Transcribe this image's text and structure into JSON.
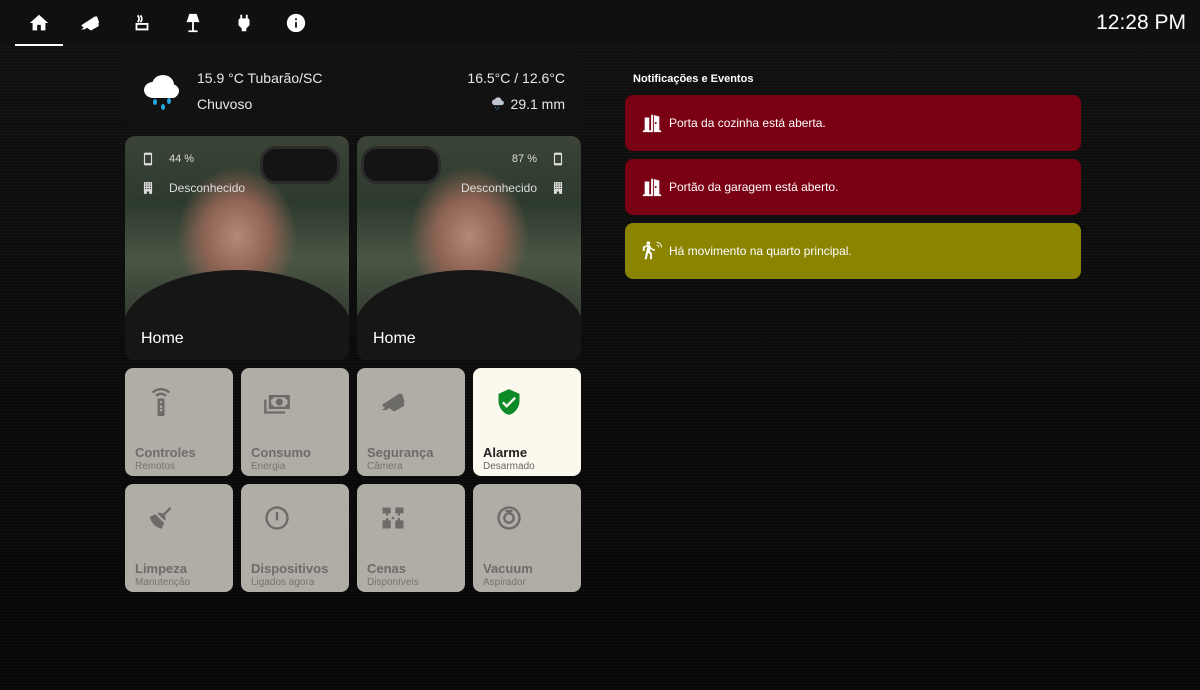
{
  "nav": {
    "tabs": [
      {
        "icon": "home-icon",
        "active": true
      },
      {
        "icon": "cctv-icon"
      },
      {
        "icon": "radiator-icon"
      },
      {
        "icon": "floor-lamp-icon"
      },
      {
        "icon": "power-plug-icon"
      },
      {
        "icon": "info-icon"
      }
    ],
    "clock": "12:28 PM"
  },
  "weather": {
    "icon": "rainy-cloud-icon",
    "temp_location": "15.9 °C Tubarão/SC",
    "condition": "Chuvoso",
    "high_low": "16.5°C / 12.6°C",
    "precipitation": "29.1 mm",
    "precip_icon": "rain-icon"
  },
  "persons": [
    {
      "battery": "44 %",
      "status": "Desconhecido",
      "name": "Home"
    },
    {
      "battery": "87 %",
      "status": "Desconhecido",
      "name": "Home"
    }
  ],
  "tiles": [
    {
      "icon": "remote-icon",
      "title": "Controles",
      "subtitle": "Remotos",
      "on": false
    },
    {
      "icon": "cash-icon",
      "title": "Consumo",
      "subtitle": "Energia",
      "on": false
    },
    {
      "icon": "cctv-icon",
      "title": "Segurança",
      "subtitle": "Câmera",
      "on": false
    },
    {
      "icon": "shield-check-icon",
      "title": "Alarme",
      "subtitle": "Desarmado",
      "on": true
    },
    {
      "icon": "broom-icon",
      "title": "Limpeza",
      "subtitle": "Manutenção",
      "on": false
    },
    {
      "icon": "power-icon",
      "title": "Dispositivos",
      "subtitle": "Ligados agora",
      "on": false
    },
    {
      "icon": "palette-icon",
      "title": "Cenas",
      "subtitle": "Disponíveis",
      "on": false
    },
    {
      "icon": "robot-vacuum-icon",
      "title": "Vacuum",
      "subtitle": "Aspirador",
      "on": false
    }
  ],
  "notifications": {
    "title": "Notificações e Eventos",
    "items": [
      {
        "icon": "door-open-icon",
        "text": "Porta da cozinha está aberta.",
        "color": "#7a0014"
      },
      {
        "icon": "door-open-icon",
        "text": "Portão da garagem está aberto.",
        "color": "#7a0014"
      },
      {
        "icon": "motion-sensor-icon",
        "text": "Há movimento na quarto principal.",
        "color": "#8a8400"
      }
    ]
  }
}
